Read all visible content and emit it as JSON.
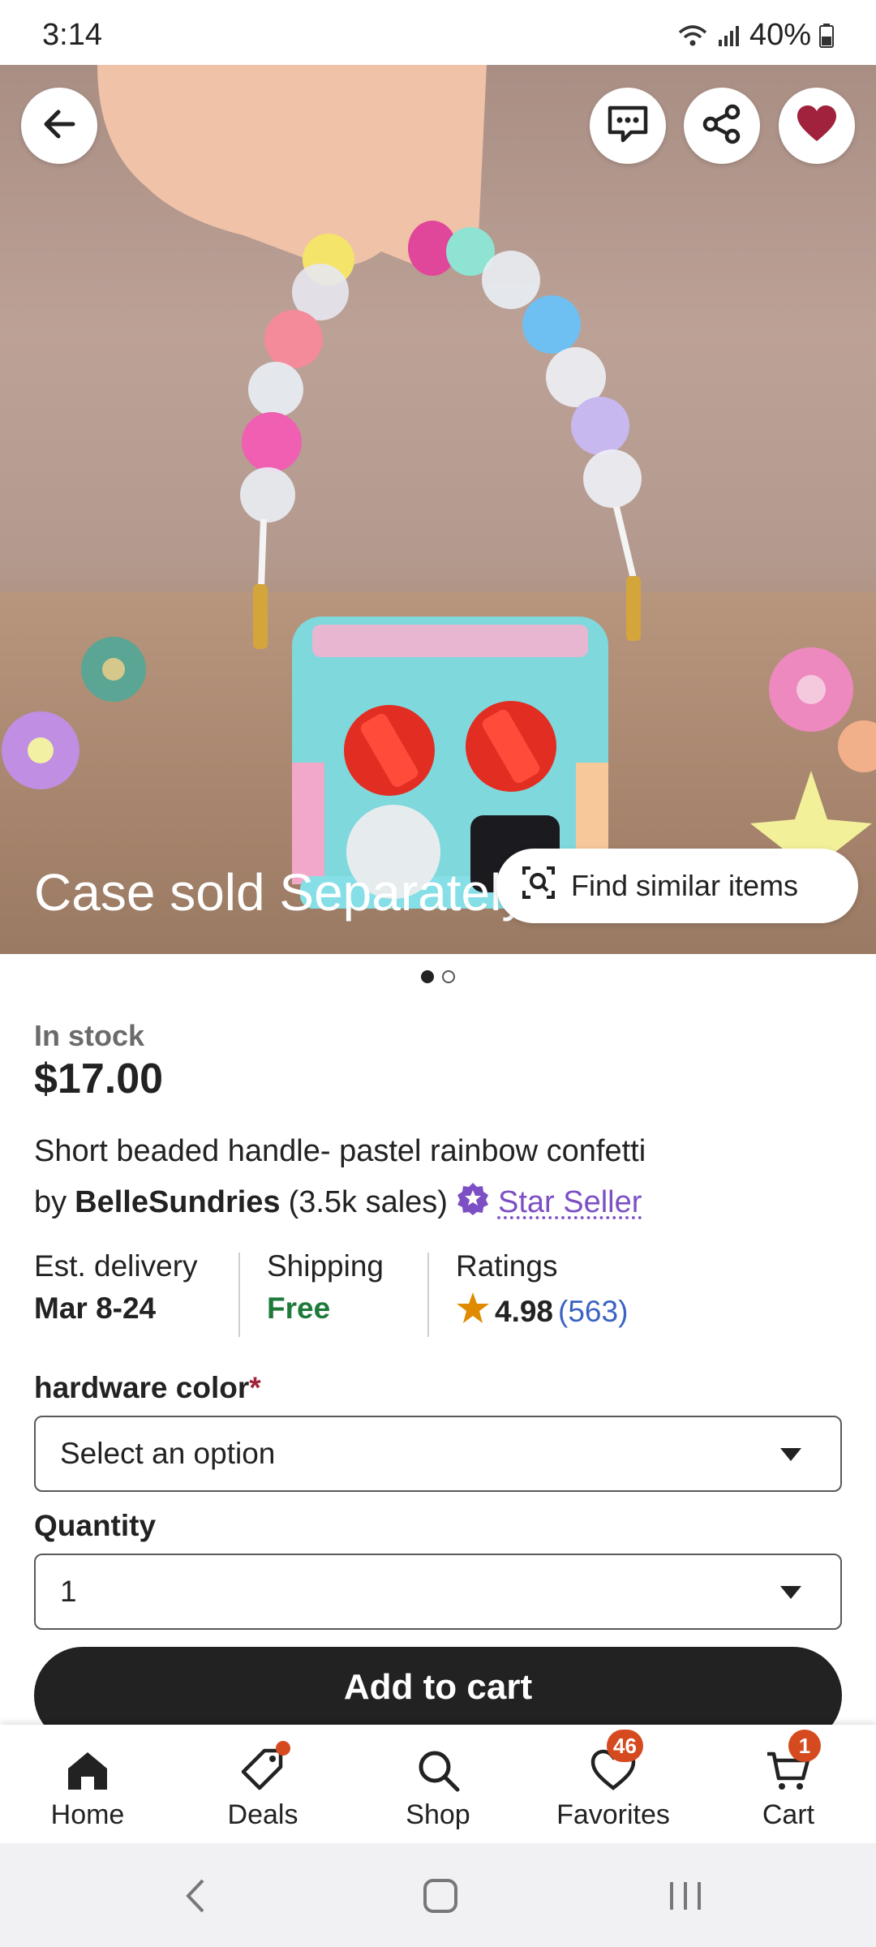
{
  "status_bar": {
    "time": "3:14",
    "battery": "40%"
  },
  "hero": {
    "overlay_text": "Case sold Separately",
    "find_similar_label": "Find similar items",
    "page_count": 2,
    "active_page": 1
  },
  "listing": {
    "stock_status": "In stock",
    "price": "$17.00",
    "title": "Short beaded handle-  pastel rainbow confetti",
    "seller_prefix": "by",
    "seller_name": "BelleSundries",
    "sales": "(3.5k sales)",
    "star_seller_label": "Star Seller"
  },
  "info": {
    "delivery_label": "Est. delivery",
    "delivery_value": "Mar 8-24",
    "shipping_label": "Shipping",
    "shipping_value": "Free",
    "ratings_label": "Ratings",
    "rating_value": "4.98",
    "rating_count": "(563)"
  },
  "options": {
    "hardware_label": "hardware color",
    "required_mark": "*",
    "hardware_value": "Select an option",
    "quantity_label": "Quantity",
    "quantity_value": "1"
  },
  "add_to_cart_label": "Add to cart",
  "bottom_nav": {
    "home": "Home",
    "deals": "Deals",
    "shop": "Shop",
    "favorites": "Favorites",
    "favorites_badge": "46",
    "cart": "Cart",
    "cart_badge": "1"
  },
  "colors": {
    "favorite_heart": "#a0223c",
    "free_shipping": "#1e7a3a",
    "star_seller": "#7d4fc4",
    "rating_star": "#e08a00",
    "badge": "#d54a1f",
    "button_dark": "#222222"
  },
  "icons": {
    "back": "arrow-left-icon",
    "message": "chat-icon",
    "share": "share-icon",
    "favorite": "heart-icon",
    "find_similar": "visual-search-icon",
    "star_seller": "star-seller-badge-icon",
    "rating": "star-icon"
  }
}
